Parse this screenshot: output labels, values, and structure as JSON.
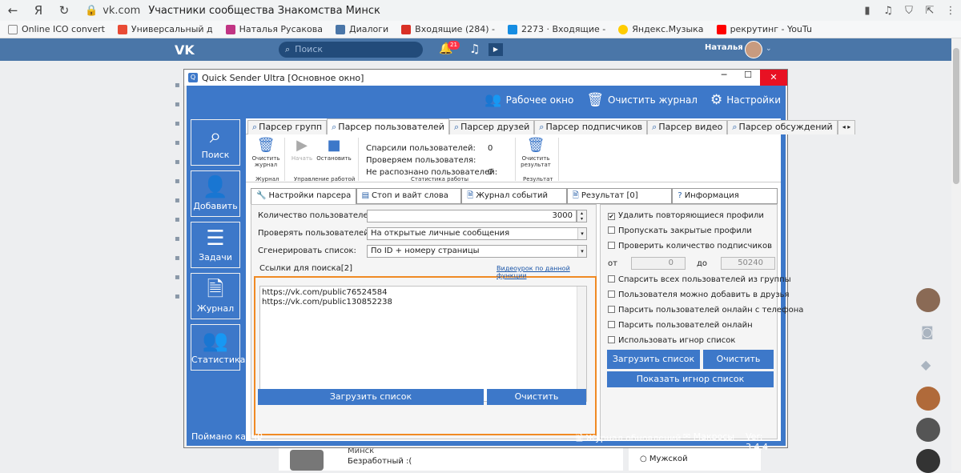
{
  "browser": {
    "host": "vk.com",
    "title": "Участники сообщества Знакомства Минск",
    "bookmarks": [
      "Online ICO convert",
      "Универсальный д",
      "Наталья Русакова",
      "Диалоги",
      "Входящие (284) -",
      "2273 · Входящие -",
      "Яндекс.Музыка",
      "рекрутинг - YouTu"
    ]
  },
  "vk": {
    "logo": "VK",
    "search_placeholder": "Поиск",
    "notif_count": "21",
    "user_name": "Наталья"
  },
  "app": {
    "title": "Quick Sender Ultra [Основное окно]",
    "toolbar": {
      "work_window": "Рабочее окно",
      "clear_log": "Очистить журнал",
      "settings": "Настройки"
    },
    "left_menu": [
      "Поиск",
      "Добавить",
      "Задачи",
      "Журнал",
      "Статистика"
    ],
    "top_tabs": [
      "Парсер групп",
      "Парсер пользователей",
      "Парсер друзей",
      "Парсер подписчиков",
      "Парсер видео",
      "Парсер обсуждений"
    ],
    "ribbon": {
      "clear_journal": "Очистить журнал",
      "journal_group": "Журнал",
      "start": "Начать",
      "stop": "Остановить",
      "manage_group": "Управление работой",
      "parsed_label": "Спарсили пользователей:",
      "parsed_value": "0",
      "checking_label": "Проверяем пользователя:",
      "unrecognized_label": "Не распознано пользователей:",
      "unrecognized_value": "0",
      "stats_group": "Статистика работы",
      "clear_result": "Очистить результат",
      "result_group": "Результат"
    },
    "sub_tabs": [
      "Настройки парсера",
      "Стоп и вайт слова",
      "Журнал событий",
      "Результат [0]",
      "Информация"
    ],
    "form": {
      "count_label": "Количество пользователей:",
      "count_value": "3000",
      "check_label": "Проверять пользователей:",
      "check_value": "На открытые личные сообщения",
      "gen_label": "Сгенерировать список:",
      "gen_value": "По ID + номеру страницы",
      "links_label": "Ссылки для поиска[2]",
      "video_link": "Видеоурок по данной функции",
      "links": [
        "https://vk.com/public76524584",
        "https://vk.com/public130852238"
      ],
      "load_button": "Загрузить список",
      "clear_button": "Очистить"
    },
    "options": {
      "checkboxes": [
        {
          "label": "Удалить повторяющиеся профили",
          "checked": true
        },
        {
          "label": "Пропускать закрытые профили",
          "checked": false
        },
        {
          "label": "Проверить количество подписчиков",
          "checked": false
        }
      ],
      "from_label": "от",
      "from_value": "0",
      "to_label": "до",
      "to_value": "50240",
      "checkboxes2": [
        {
          "label": "Спарсить всех пользователей из группы",
          "checked": false
        },
        {
          "label": "Пользователя можно добавить в друзья",
          "checked": false
        },
        {
          "label": "Парсить пользователей онлайн с телефона",
          "checked": false
        },
        {
          "label": "Парсить пользователей онлайн",
          "checked": false
        },
        {
          "label": "Использовать игнор список",
          "checked": false
        }
      ],
      "load_button": "Загрузить список",
      "clear_button": "Очистить",
      "show_ignore": "Показать игнор список"
    },
    "status": {
      "captcha_label": "Поймано капч:",
      "captcha_value": "0",
      "updates_log": "Журнал обновлений",
      "macros": "Макросы",
      "version": "Ver: 3.4.4"
    }
  },
  "background": {
    "person_line1": "Минск",
    "person_line2": "Безработный :(",
    "radio_male": "Мужской"
  },
  "colors": {
    "accent": "#3d78c9",
    "vk_blue": "#4a76a8",
    "highlight": "#f08a24"
  }
}
